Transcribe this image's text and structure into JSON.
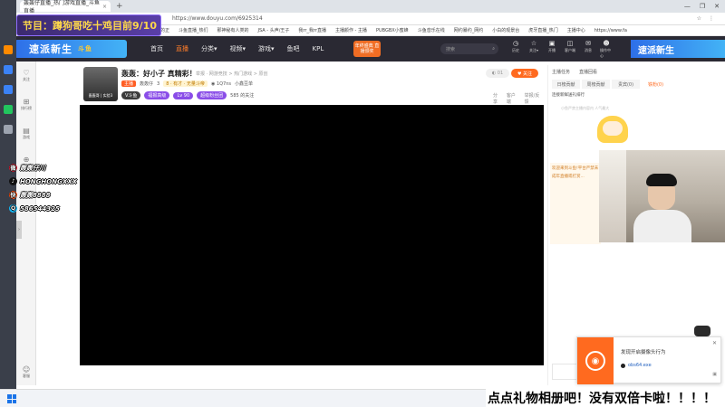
{
  "browser": {
    "tab_title": "轰轰仔直播_热门游戏直播_斗鱼直播",
    "tab_close": "×",
    "new_tab": "+",
    "url": "https://www.douyu.com/6925314",
    "window_controls": [
      "—",
      "❐",
      "✕"
    ],
    "address_icons": [
      "☆",
      "⋮"
    ],
    "bookmarks": [
      "人的正",
      "斗鱼直播_热们",
      "那神秘有人类的",
      "JSA - 头声/王子",
      "我rr_我rr直播",
      "主播颜作 - 主播",
      "PUBGBX小蜜蜂",
      "斗鱼音乐在线",
      "网约暴约_网约",
      "小白的观景台",
      "虎牙直播_热门",
      "主播中心",
      "https://www.fa"
    ]
  },
  "overlay": {
    "program_text": "节目：蹲狗哥吃十鸡目前9/10",
    "socials": [
      {
        "icon": "weibo-icon",
        "glyph": "微",
        "color": "#e6162d",
        "text": "轰轰仔川"
      },
      {
        "icon": "tiktok-icon",
        "glyph": "♪",
        "color": "#111111",
        "text": "HONGHONGXXX"
      },
      {
        "icon": "kuaishou-icon",
        "glyph": "快",
        "color": "#ff4906",
        "text": "轰轰8888"
      },
      {
        "icon": "qq-icon",
        "glyph": "Q",
        "color": "#12b7f5",
        "text": "586544325"
      }
    ],
    "marquee": "点点礼物相册吧！没有双倍卡啦！！！！"
  },
  "site": {
    "brand_banner": "速派新生",
    "brand_mini": "斗鱼",
    "nav": [
      {
        "label": "首页",
        "active": false
      },
      {
        "label": "直播",
        "active": true
      },
      {
        "label": "分类▾",
        "active": false
      },
      {
        "label": "视频▾",
        "active": false
      },
      {
        "label": "游戏▾",
        "active": false
      },
      {
        "label": "鱼吧",
        "active": false
      },
      {
        "label": "KPL",
        "active": false
      }
    ],
    "promo": "年终盛典 直播颁奖",
    "search_placeholder": "搜索",
    "search_icon": "⌕",
    "top_icons": [
      {
        "glyph": "◷",
        "label": "历史"
      },
      {
        "glyph": "☆",
        "label": "关注▾"
      },
      {
        "glyph": "▣",
        "label": "开播"
      },
      {
        "glyph": "◫",
        "label": "客户端"
      },
      {
        "glyph": "✉",
        "label": "消息"
      },
      {
        "glyph": "☻",
        "label": "操作中心"
      }
    ],
    "right_banner": "速派新生"
  },
  "sidebar": {
    "items": [
      {
        "glyph": "♡",
        "label": "关注"
      },
      {
        "glyph": "⊞",
        "label": "排行榜"
      },
      {
        "glyph": "▤",
        "label": "游戏"
      },
      {
        "glyph": "⊕",
        "label": "分类"
      }
    ],
    "bottom": {
      "glyph": "☺",
      "label": "客服"
    },
    "collapse": "›"
  },
  "room": {
    "avatar_name": "轰轰哥 | 实验3",
    "title": "轰轰：好小子 真精彩！",
    "meta": "举报 · 网游竞技 > 热门游戏 > 原创",
    "badges": [
      "主播",
      "轰轰仔",
      "3",
      "8 · 有才 · 无量斗帝",
      "◉ 1Q7ns",
      "小鑫豆单"
    ],
    "row3": [
      "V斗鱼",
      "福报高级",
      "Lv 90",
      "超级粉丝团",
      "585 的关注"
    ],
    "follow_count": "◐ 01",
    "follow_label": "♥ 关注",
    "tools": [
      "分享",
      "客户端",
      "举报/反馈"
    ]
  },
  "right_panel": {
    "top": [
      "主播任务",
      "直播回看"
    ],
    "tabs": [
      {
        "label": "日榜贡献",
        "on": false
      },
      {
        "label": "周榜贡献",
        "on": false
      },
      {
        "label": "贵宾(0)",
        "on": false
      },
      {
        "label": "铁粉(0)",
        "on": true
      }
    ],
    "desc": "连接新鲜送礼排行",
    "empty": "小鱼严禁主播内容内 人气最大",
    "chat": "欢迎来到斗鱼!平台严禁未成年直播或打赏..."
  },
  "notification": {
    "title": "发现开启摄像头行为",
    "app": "obs64.exe",
    "close": "✕",
    "action": "▣"
  },
  "colors": {
    "accent": "#ff6a1f",
    "nav_bg": "#2a2933",
    "banner_blue": "#2e6fe8",
    "overlay_purple": "#5a3fa8",
    "overlay_yellow": "#ffd84a"
  }
}
